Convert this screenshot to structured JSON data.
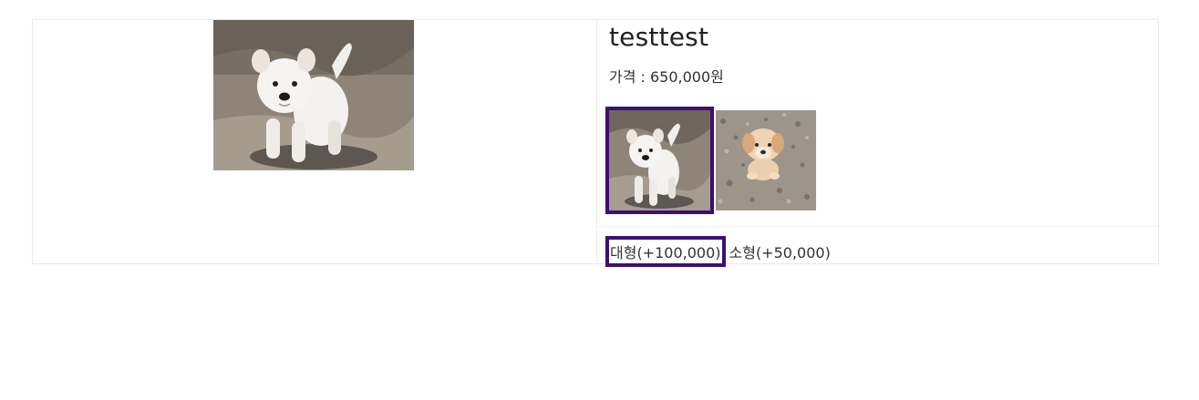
{
  "product": {
    "name": "testtest",
    "price_label": "가격 : 650,000원"
  },
  "images": {
    "main": {
      "icon": "white-puppy-photo"
    },
    "thumbnails": [
      {
        "icon": "white-puppy-photo",
        "selected": true
      },
      {
        "icon": "tan-puppy-photo",
        "selected": false
      }
    ]
  },
  "options": [
    {
      "label": "대형(+100,000)",
      "selected": true
    },
    {
      "label": "소형(+50,000)",
      "selected": false
    }
  ],
  "colors": {
    "selection_border": "#3d0f74",
    "card_border": "#e9e9e9"
  }
}
